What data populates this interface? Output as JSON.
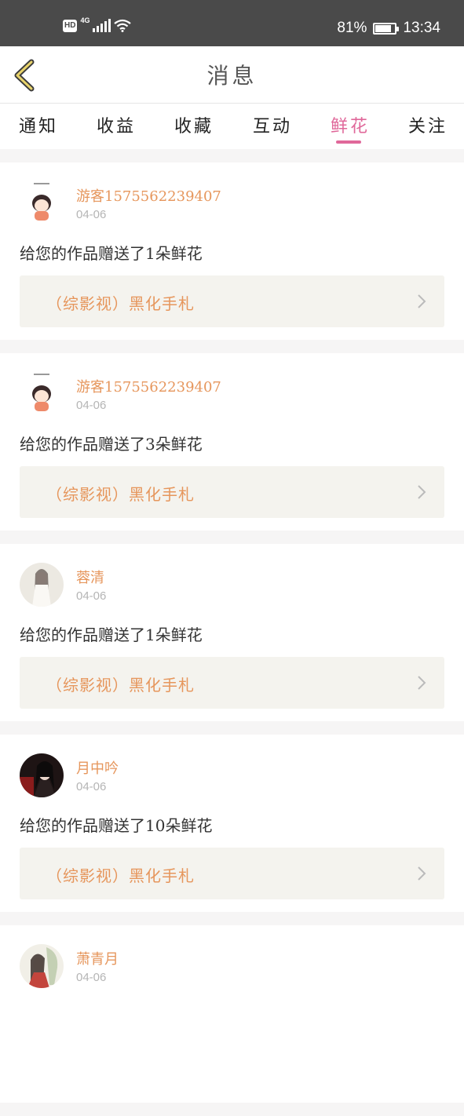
{
  "status_bar": {
    "hd_badge": "HD",
    "network": "4G",
    "battery": "81%",
    "battery_level": 0.81,
    "time": "13:34"
  },
  "nav": {
    "title": "消息",
    "back_icon": "chevron-left-icon"
  },
  "tabs": [
    {
      "label": "通知",
      "active": false
    },
    {
      "label": "收益",
      "active": false
    },
    {
      "label": "收藏",
      "active": false
    },
    {
      "label": "互动",
      "active": false
    },
    {
      "label": "鲜花",
      "active": true
    },
    {
      "label": "关注",
      "active": false
    }
  ],
  "colors": {
    "accent_pink": "#e0689a",
    "username_orange": "#e6965c",
    "link_bg": "#f4f3ee"
  },
  "messages": [
    {
      "username": "游客1575562239407",
      "date": "04-06",
      "text": "给您的作品赠送了1朵鲜花",
      "work_title": "（综影视）黑化手札"
    },
    {
      "username": "游客1575562239407",
      "date": "04-06",
      "text": "给您的作品赠送了3朵鲜花",
      "work_title": "（综影视）黑化手札"
    },
    {
      "username": "蓉清",
      "date": "04-06",
      "text": "给您的作品赠送了1朵鲜花",
      "work_title": "（综影视）黑化手札"
    },
    {
      "username": "月中吟",
      "date": "04-06",
      "text": "给您的作品赠送了10朵鲜花",
      "work_title": "（综影视）黑化手札"
    },
    {
      "username": "萧青月",
      "date": "04-06",
      "text": "",
      "work_title": ""
    }
  ]
}
